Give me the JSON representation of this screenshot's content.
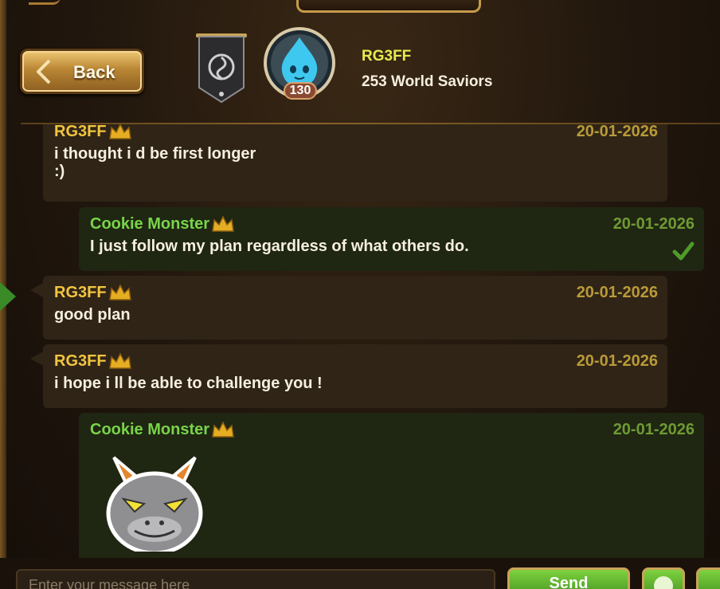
{
  "header": {
    "back_label": "Back",
    "player_name": "RG3FF",
    "guild_name": "253 World Saviors",
    "level": "130"
  },
  "messages": [
    {
      "sender": "RG3FF",
      "side": "other",
      "date": "20-01-2026",
      "text": "i thought i d be first longer\n:)"
    },
    {
      "sender": "Cookie Monster",
      "side": "mine",
      "date": "20-01-2026",
      "text": "I just follow my plan regardless of what others do.",
      "delivered": true
    },
    {
      "sender": "RG3FF",
      "side": "other",
      "date": "20-01-2026",
      "text": "good plan"
    },
    {
      "sender": "RG3FF",
      "side": "other",
      "date": "20-01-2026",
      "text": "i hope i ll be able to challenge you !"
    },
    {
      "sender": "Cookie Monster",
      "side": "mine",
      "date": "20-01-2026",
      "text": "",
      "sticker": "gargoyle-sticker"
    }
  ],
  "input": {
    "placeholder": "Enter your message here",
    "send_label": "Send"
  },
  "colors": {
    "other_name": "#f2c53f",
    "mine_name": "#79d44a",
    "accent_gold": "#c9a458",
    "send_green": "#5fb22e"
  }
}
